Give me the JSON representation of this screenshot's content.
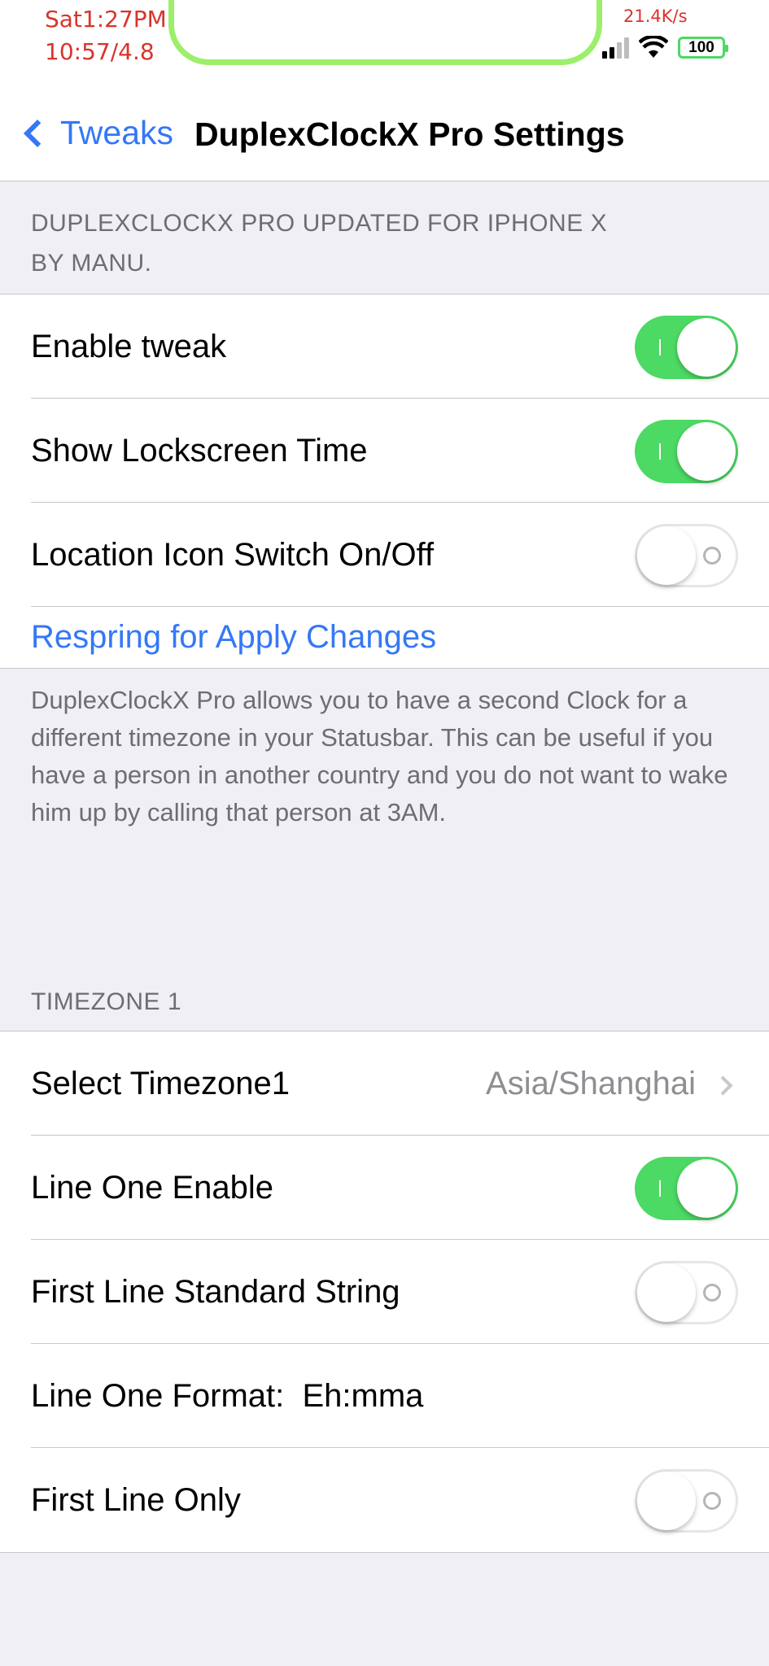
{
  "status_bar": {
    "left_line1": "Sat1:27PM",
    "left_line2": "10:57/4.8",
    "net_speed": "21.4K/s",
    "battery": "100",
    "icons": [
      "signal-icon",
      "wifi-icon",
      "battery-icon"
    ],
    "accent_color": "#d9342b"
  },
  "nav": {
    "back_label": "Tweaks",
    "title": "DuplexClockX Pro Settings"
  },
  "section1": {
    "header": "DUPLEXCLOCKX PRO UPDATED FOR IPHONE X\nBY MANU.",
    "rows": [
      {
        "label": "Enable tweak",
        "toggle": true
      },
      {
        "label": "Show Lockscreen Time",
        "toggle": true
      },
      {
        "label": "Location Icon Switch On/Off",
        "toggle": false
      }
    ],
    "link": "Respring for Apply Changes",
    "footer": "DuplexClockX Pro allows you to have a second Clock for a different timezone in your Statusbar. This can be useful if you have a person in another country and you do not want to wake him up by calling that person at 3AM."
  },
  "section2": {
    "header": "TIMEZONE 1",
    "select_label": "Select Timezone1",
    "select_value": "Asia/Shanghai",
    "rows": [
      {
        "label": "Line One Enable",
        "toggle": true
      },
      {
        "label": "First Line Standard String",
        "toggle": false
      },
      {
        "label": "Line One Format:  Eh:mma"
      },
      {
        "label": "First Line Only",
        "toggle": false
      }
    ]
  },
  "colors": {
    "tint": "#3478f6",
    "switch_on": "#4cd964",
    "background": "#efeff4"
  }
}
